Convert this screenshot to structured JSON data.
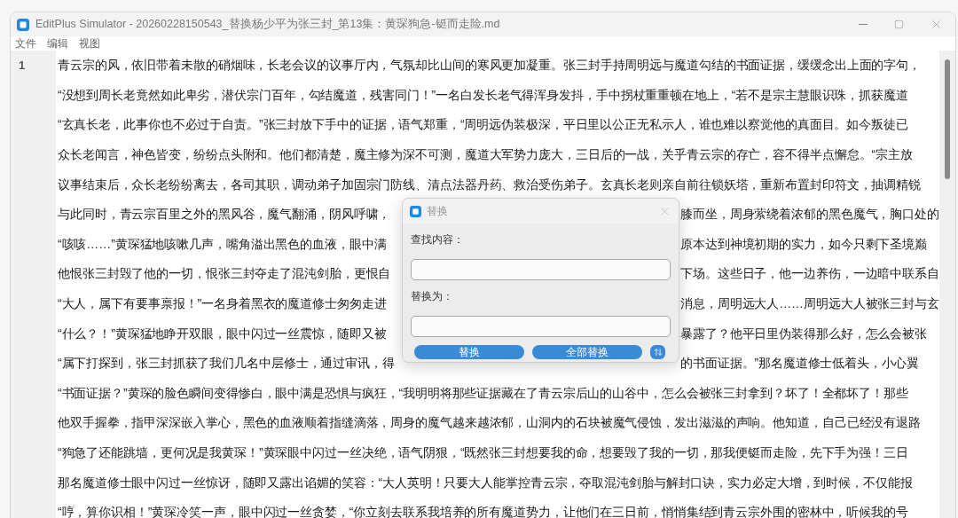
{
  "window": {
    "title": "EditPlus Simulator - 20260228150543_替换杨少平为张三封_第13集：黄琛狗急-铤而走险.md"
  },
  "menu": [
    "文件",
    "编辑",
    "视图"
  ],
  "editor": {
    "line_number": "1",
    "lines": [
      {
        "segments": [
          "青云宗的风，依旧带着未散的硝烟味，长老会议的议事厅内，气氛却比山间的寒风更加凝重。张三封手持周明远与魔道勾结的书面证据，缓缓念出上面的字句，"
        ]
      },
      {
        "segments": [
          "“没想到周长老竟然如此卑劣，潜伏宗门百年，勾结魔道，残害同门！”一名白发长老气得浑身发抖，手中拐杖重重顿在地上，“若不是宗主慧眼识珠，抓获魔道"
        ]
      },
      {
        "segments": [
          "“玄真长老，此事你也不必过于自责。”张三封放下手中的证据，语气郑重，“周明远伪装极深，平日里以公正无私示人，谁也难以察觉他的真面目。如今叛徒已"
        ]
      },
      {
        "segments": [
          "众长老闻言，神色皆变，纷纷点头附和。他们都清楚，魔主修为深不可测，魔道大军势力庞大，三日后的一战，关乎青云宗的存亡，容不得半点懈怠。“宗主放"
        ]
      },
      {
        "segments": [
          "议事结束后，众长老纷纷离去，各司其职，调动弟子加固宗门防线、清点法器丹药、救治受伤弟子。玄真长老则亲自前往锁妖塔，重新布置封印符文，抽调精锐"
        ]
      },
      {
        "segments": [
          "与此同时，青云宗百里之外的黑风谷，魔气翻涌，阴风呼啸，",
          "膝而坐，周身萦绕着浓郁的黑色魔气，胸口处的"
        ]
      },
      {
        "segments": [
          "“咳咳……”黄琛猛地咳嗽几声，嘴角溢出黑色的血液，眼中满",
          "原本达到神境初期的实力，如今只剩下圣境巅"
        ]
      },
      {
        "segments": [
          "他恨张三封毁了他的一切，恨张三封夺走了混沌剑胎，更恨自",
          "下场。这些日子，他一边养伤，一边暗中联系自"
        ]
      },
      {
        "segments": [
          "“大人，属下有要事禀报！”一名身着黑衣的魔道修士匆匆走进",
          "消息，周明远大人……周明远大人被张三封与玄"
        ]
      },
      {
        "segments": [
          "“什么？！”黄琛猛地睁开双眼，眼中闪过一丝震惊，随即又被",
          "暴露了？他平日里伪装得那么好，怎么会被张"
        ]
      },
      {
        "segments": [
          "“属下打探到，张三封抓获了我们几名中层修士，通过审讯，得",
          "的书面证据。”那名魔道修士低着头，小心翼"
        ]
      },
      {
        "segments": [
          "“书面证据？”黄琛的脸色瞬间变得惨白，眼中满是恐惧与疯狂，“我明明将那些证据藏在了青云宗后山的山谷中，怎么会被张三封拿到？坏了！全都坏了！那些"
        ]
      },
      {
        "segments": [
          "他双手握拳，指甲深深嵌入掌心，黑色的血液顺着指缝滴落，周身的魔气越来越浓郁，山洞内的石块被魔气侵蚀，发出滋滋的声响。他知道，自己已经没有退路"
        ]
      },
      {
        "segments": [
          "“狗急了还能跳墙，更何况是我黄琛！”黄琛眼中闪过一丝决绝，语气阴狠，“既然张三封想要我的命，想要毁了我的一切，那我便铤而走险，先下手为强！三日"
        ]
      },
      {
        "segments": [
          "那名魔道修士眼中闪过一丝惊讶，随即又露出谄媚的笑容：“大人英明！只要大人能掌控青云宗，夺取混沌剑胎与解封口诀，实力必定大增，到时候，不仅能报"
        ]
      },
      {
        "segments": [
          "“哼，算你识相！”黄琛冷笑一声，眼中闪过一丝贪婪，“你立刻去联系我培养的所有魔道势力，让他们在三日前，悄悄集结到青云宗外围的密林中，听候我的号"
        ]
      }
    ]
  },
  "dialog": {
    "title": "替换",
    "fields": [
      {
        "label": "查找内容："
      },
      {
        "label": "替换为："
      }
    ],
    "buttons": [
      "替换",
      "全部替换"
    ]
  }
}
